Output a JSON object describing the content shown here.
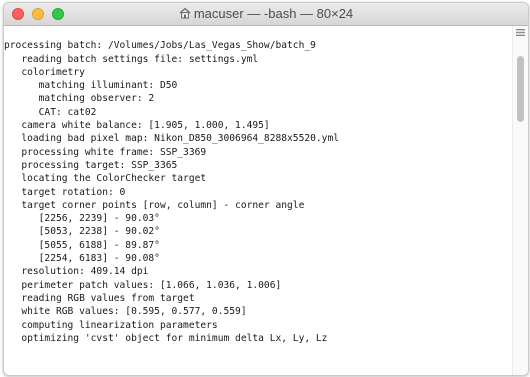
{
  "window": {
    "title": "macuser — -bash — 80×24"
  },
  "colors": {
    "close": "#fc605c",
    "minimize": "#fdbc40",
    "maximize": "#34c84a",
    "text": "#1a1a1a",
    "background": "#ffffff"
  },
  "terminal": {
    "lines": [
      "",
      "processing batch: /Volumes/Jobs/Las_Vegas_Show/batch_9",
      "   reading batch settings file: settings.yml",
      "   colorimetry",
      "      matching illuminant: D50",
      "      matching observer: 2",
      "      CAT: cat02",
      "   camera white balance: [1.905, 1.000, 1.495]",
      "   loading bad pixel map: Nikon_D850_3006964_8288x5520.yml",
      "   processing white frame: SSP_3369",
      "   processing target: SSP_3365",
      "   locating the ColorChecker target",
      "   target rotation: 0",
      "   target corner points [row, column] - corner angle",
      "      [2256, 2239] - 90.03°",
      "      [5053, 2238] - 90.02°",
      "      [5055, 6188] - 89.87°",
      "      [2254, 6183] - 90.08°",
      "   resolution: 409.14 dpi",
      "   perimeter patch values: [1.066, 1.036, 1.006]",
      "   reading RGB values from target",
      "   white RGB values: [0.595, 0.577, 0.559]",
      "   computing linearization parameters",
      "   optimizing 'cvst' object for minimum delta Lx, Ly, Lz"
    ]
  },
  "icons": {
    "title": "home-icon",
    "scroll": "scroll-corner-icon"
  }
}
